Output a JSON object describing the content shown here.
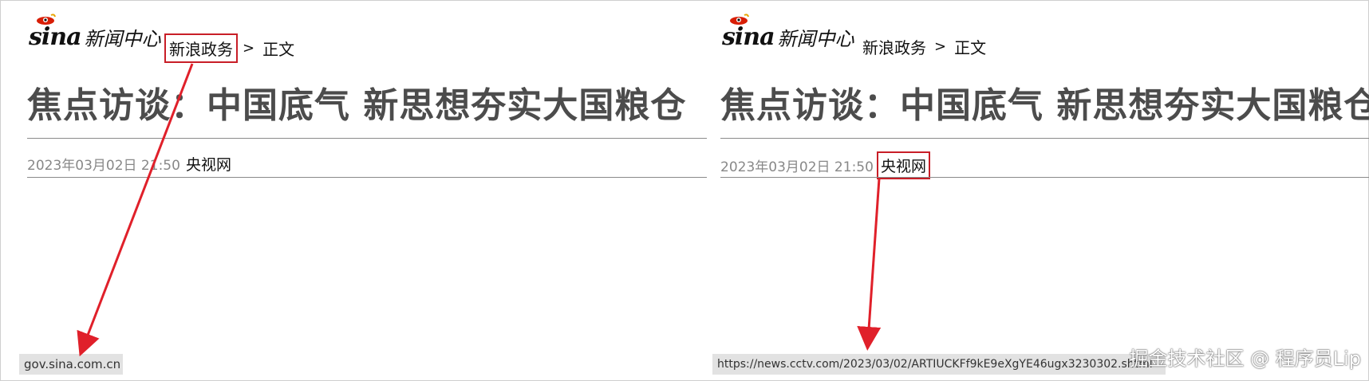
{
  "colors": {
    "highlight": "#c81e27",
    "title": "#4c4c4c",
    "date": "#888888",
    "statusbar_bg": "#e2e2e2"
  },
  "left": {
    "logo": {
      "brand": "sina",
      "section": "新闻中心",
      "icon": "sina-eye-logo"
    },
    "breadcrumb": {
      "category": "新浪政务",
      "separator": ">",
      "current": "正文"
    },
    "article": {
      "title": "焦点访谈：中国底气 新思想夯实大国粮仓",
      "date": "2023年03月02日 21:50",
      "source": "央视网"
    },
    "statusbar": {
      "url": "gov.sina.com.cn"
    }
  },
  "right": {
    "logo": {
      "brand": "sina",
      "section": "新闻中心",
      "icon": "sina-eye-logo"
    },
    "breadcrumb": {
      "category": "新浪政务",
      "separator": ">",
      "current": "正文"
    },
    "article": {
      "title": "焦点访谈：中国底气 新思想夯实大国粮仓",
      "date": "2023年03月02日 21:50",
      "source": "央视网"
    },
    "statusbar": {
      "url": "https://news.cctv.com/2023/03/02/ARTIUCKFf9kE9eXgYE46ugx3230302.shtml"
    }
  },
  "watermark": "掘金技术社区 @ 程序员Lip"
}
